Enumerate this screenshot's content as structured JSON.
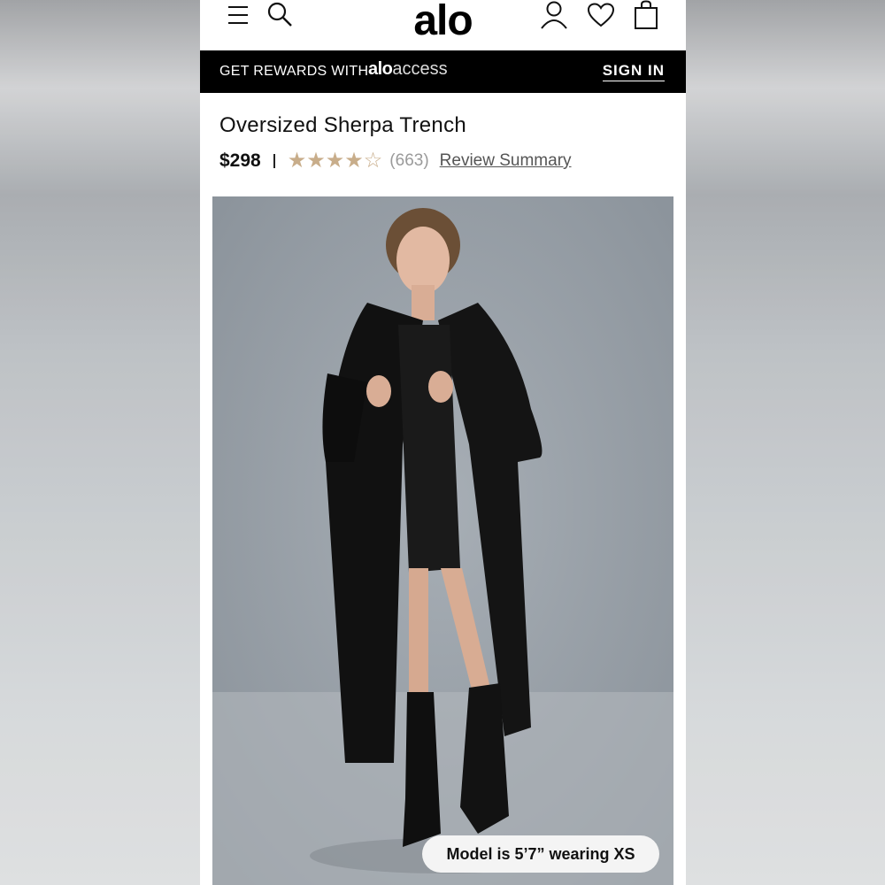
{
  "header": {
    "logo_text": "alo",
    "icons": [
      "menu-icon",
      "search-icon",
      "account-icon",
      "wishlist-heart-icon",
      "shopping-bag-icon"
    ]
  },
  "rewards_banner": {
    "text": "GET REWARDS WITH",
    "brand_bold": "alo",
    "brand_light": "access",
    "sign_in_label": "SIGN IN"
  },
  "product": {
    "title": "Oversized Sherpa Trench",
    "price": "$298",
    "rating": 4,
    "rating_max": 5,
    "review_count": "(663)",
    "review_summary_label": "Review Summary"
  },
  "image": {
    "caption": "Model is 5’7” wearing XS"
  },
  "colors": {
    "banner_bg": "#000000",
    "star_color": "#c8ad8a",
    "photo_bg": "#9aa2aa"
  }
}
